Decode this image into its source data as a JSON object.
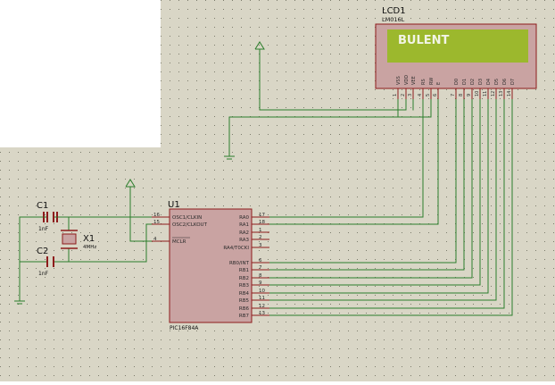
{
  "colors": {
    "sheet": "#d9d6c6",
    "grid": "#7c7c6c",
    "wire": "#2c7d2c",
    "body": "#c9a3a2",
    "outline": "#8d1b1b",
    "pin_text": "#2a2a2a",
    "lcd_screen": "#9cb82d",
    "lcd_text": "#f2f4e6",
    "ref_text": "#111111"
  },
  "lcd": {
    "ref": "LCD1",
    "part": "LM016L",
    "display_text": "BULENT",
    "pins": [
      {
        "num": "1",
        "name": "VSS"
      },
      {
        "num": "2",
        "name": "VDD"
      },
      {
        "num": "3",
        "name": "VEE"
      },
      {
        "num": "4",
        "name": "RS"
      },
      {
        "num": "5",
        "name": "RW"
      },
      {
        "num": "6",
        "name": "E"
      },
      {
        "num": "7",
        "name": "D0"
      },
      {
        "num": "8",
        "name": "D1"
      },
      {
        "num": "9",
        "name": "D2"
      },
      {
        "num": "10",
        "name": "D3"
      },
      {
        "num": "11",
        "name": "D4"
      },
      {
        "num": "12",
        "name": "D5"
      },
      {
        "num": "13",
        "name": "D6"
      },
      {
        "num": "14",
        "name": "D7"
      }
    ]
  },
  "mcu": {
    "ref": "U1",
    "part": "PIC16F84A",
    "left_pins": [
      {
        "num": "16",
        "name": "OSC1/CLKIN"
      },
      {
        "num": "15",
        "name": "OSC2/CLKOUT"
      },
      {
        "num": "4",
        "name": "MCLR"
      }
    ],
    "right_pins": [
      {
        "num": "17",
        "name": "RA0"
      },
      {
        "num": "18",
        "name": "RA1"
      },
      {
        "num": "1",
        "name": "RA2"
      },
      {
        "num": "2",
        "name": "RA3"
      },
      {
        "num": "3",
        "name": "RA4/T0CKI"
      },
      {
        "num": "6",
        "name": "RB0/INT"
      },
      {
        "num": "7",
        "name": "RB1"
      },
      {
        "num": "8",
        "name": "RB2"
      },
      {
        "num": "9",
        "name": "RB3"
      },
      {
        "num": "10",
        "name": "RB4"
      },
      {
        "num": "11",
        "name": "RB5"
      },
      {
        "num": "12",
        "name": "RB6"
      },
      {
        "num": "13",
        "name": "RB7"
      }
    ]
  },
  "c1": {
    "ref": "C1",
    "value": "1nF"
  },
  "c2": {
    "ref": "C2",
    "value": "1nF"
  },
  "crystal": {
    "ref": "X1",
    "value": "4MHz"
  }
}
